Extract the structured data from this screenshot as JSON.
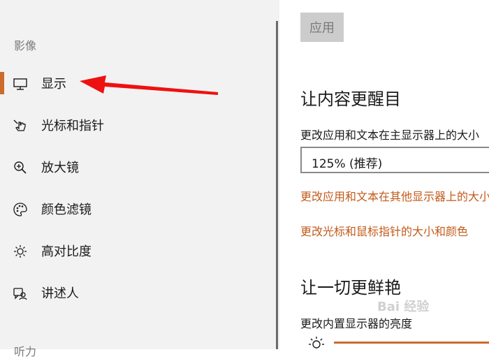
{
  "sidebar": {
    "section_vision": "影像",
    "section_hearing": "听力",
    "items": [
      {
        "label": "显示",
        "icon": "monitor-icon",
        "active": true
      },
      {
        "label": "光标和指针",
        "icon": "pointer-icon"
      },
      {
        "label": "放大镜",
        "icon": "magnifier-icon"
      },
      {
        "label": "颜色滤镜",
        "icon": "palette-icon"
      },
      {
        "label": "高对比度",
        "icon": "brightness-icon"
      },
      {
        "label": "讲述人",
        "icon": "narrator-icon"
      }
    ]
  },
  "main": {
    "apply_label": "应用",
    "heading1": "让内容更醒目",
    "scale_label": "更改应用和文本在主显示器上的大小",
    "scale_value": "125% (推荐)",
    "link_other_displays": "更改应用和文本在其他显示器上的大小",
    "link_cursor": "更改光标和鼠标指针的大小和颜色",
    "heading2": "让一切更鲜艳",
    "brightness_label": "更改内置显示器的亮度",
    "brightness_level": 0.95
  },
  "watermark": "Bai 经验",
  "colors": {
    "accent": "#cc6b2c",
    "link": "#c25a1a",
    "sidebar_bg": "#f2f2f2",
    "arrow": "#ee1111"
  }
}
